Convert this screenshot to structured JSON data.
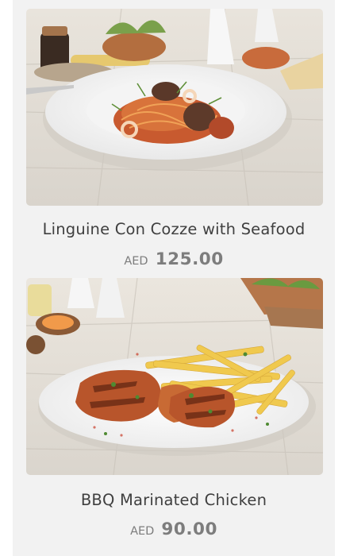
{
  "menu": {
    "items": [
      {
        "name": "Linguine Con Cozze with Seafood",
        "currency": "AED",
        "price": "125.00"
      },
      {
        "name": "BBQ Marinated Chicken",
        "currency": "AED",
        "price": "90.00"
      }
    ]
  }
}
